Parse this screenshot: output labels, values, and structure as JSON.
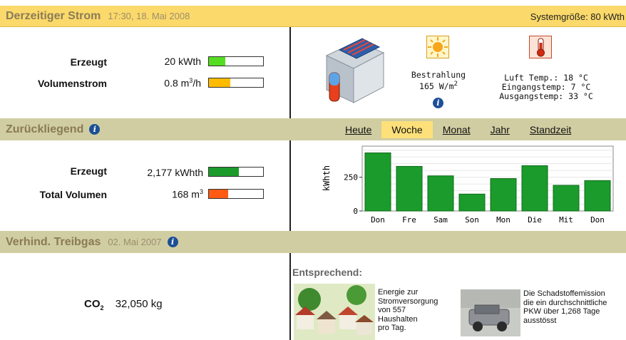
{
  "current": {
    "title": "Derzeitiger Strom",
    "timestamp": "17:30, 18. Mai 2008",
    "system_size": "Systemgröße: 80 kWth",
    "rows": [
      {
        "label": "Erzeugt",
        "value": "20 kWth",
        "fill": 0.3,
        "color": "#55dd22"
      },
      {
        "label": "Volumenstrom",
        "value_main": "0.8 m",
        "value_sup": "3",
        "value_tail": "/h",
        "fill": 0.4,
        "color": "#ffbb00"
      }
    ],
    "irradiance": {
      "label": "Bestrahlung",
      "value_main": "165 W/m",
      "value_sup": "2"
    },
    "temps": {
      "air": "Luft Temp.: 18 °C",
      "inlet": "Eingangstemp: 7 °C",
      "outlet": "Ausgangstemp: 33 °C"
    },
    "colors": {
      "header_bg": "#fbd96a",
      "title": "#8b7c59"
    }
  },
  "history": {
    "title": "Zurückliegend",
    "tabs": [
      "Heute",
      "Woche",
      "Monat",
      "Jahr",
      "Standzeit"
    ],
    "active_tab": "Woche",
    "rows": [
      {
        "label": "Erzeugt",
        "value": "2,177 kWhth",
        "fill": 0.55,
        "color": "#1b9b2b"
      },
      {
        "label": "Total Volumen",
        "value_main": "168 m",
        "value_sup": "3",
        "fill": 0.35,
        "color": "#ff5a11"
      }
    ]
  },
  "chart_data": {
    "type": "bar",
    "categories": [
      "Don",
      "Fre",
      "Sam",
      "Son",
      "Mon",
      "Die",
      "Mit",
      "Don"
    ],
    "values": [
      430,
      330,
      260,
      125,
      240,
      335,
      190,
      225
    ],
    "ylabel": "kWhth",
    "yticks": [
      0,
      250
    ],
    "ylim": [
      0,
      480
    ],
    "color": "#1b9b2b",
    "grid": true
  },
  "avoided": {
    "title": "Verhind. Treibgas",
    "date": "02. Mai 2007",
    "co2_label_main": "CO",
    "co2_label_sub": "2",
    "co2_value": "32,050 kg",
    "equivalent_heading": "Entsprechend:",
    "eq_households": [
      "Energie zur",
      "Stromversorgung",
      "von 557",
      "Haushalten",
      "pro Tag."
    ],
    "eq_car": [
      "Die Schadstoffemission",
      "die ein durchschnittliche",
      "PKW über 1,268 Tage",
      "ausstösst"
    ]
  },
  "icons": {
    "info": "info-icon",
    "collector": "solar-collector-icon",
    "sun": "sun-icon",
    "thermometer": "thermometer-icon",
    "houses": "houses-illustration",
    "car": "car-illustration"
  },
  "info_glyph": "i"
}
